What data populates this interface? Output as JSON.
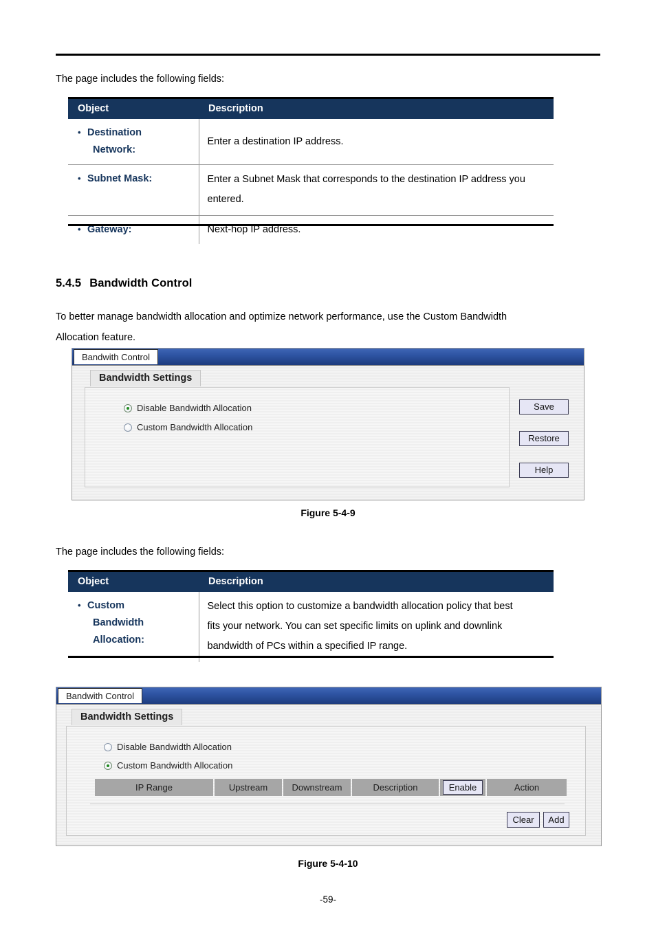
{
  "document": {
    "page_number": "-59-"
  },
  "intro_text_1": "The page includes the following fields:",
  "intro_text_2": "The page includes the following fields:",
  "section": {
    "number": "5.4.5",
    "title": "Bandwidth Control",
    "paragraph_line1": "To better manage bandwidth allocation and optimize network performance, use the Custom Bandwidth",
    "paragraph_line2": "Allocation feature."
  },
  "table1": {
    "headers": {
      "object": "Object",
      "description": "Description"
    },
    "rows": [
      {
        "object_lines": [
          "Destination",
          "Network:"
        ],
        "description_lines": [
          "Enter a destination IP address."
        ]
      },
      {
        "object_lines": [
          "Subnet Mask:"
        ],
        "description_lines": [
          "Enter a Subnet Mask that corresponds to the destination IP address you",
          "entered."
        ]
      },
      {
        "object_lines": [
          "Gateway:"
        ],
        "description_lines": [
          "Next-hop IP address."
        ]
      }
    ]
  },
  "table2": {
    "headers": {
      "object": "Object",
      "description": "Description"
    },
    "rows": [
      {
        "object_lines": [
          "Custom",
          "Bandwidth",
          "Allocation:"
        ],
        "description_lines": [
          "Select this option to customize a bandwidth allocation policy that best",
          "fits your network. You can set specific limits on uplink and downlink",
          "bandwidth of PCs within a specified IP range."
        ]
      }
    ]
  },
  "figure1": {
    "caption": "Figure 5-4-9",
    "tab_label": "Bandwith Control",
    "panel_tab_label": "Bandwidth Settings",
    "radios": [
      {
        "label": "Disable Bandwidth Allocation",
        "selected": true
      },
      {
        "label": "Custom Bandwidth Allocation",
        "selected": false
      }
    ],
    "buttons": {
      "save": "Save",
      "restore": "Restore",
      "help": "Help"
    }
  },
  "figure2": {
    "caption": "Figure 5-4-10",
    "tab_label": "Bandwith Control",
    "panel_tab_label": "Bandwidth Settings",
    "radios": [
      {
        "label": "Disable Bandwidth Allocation",
        "selected": false
      },
      {
        "label": "Custom Bandwidth Allocation",
        "selected": true
      }
    ],
    "grid_headers": {
      "ip_range": "IP Range",
      "upstream": "Upstream",
      "downstream": "Downstream",
      "description": "Description",
      "enable": "Enable",
      "action": "Action"
    },
    "buttons": {
      "clear": "Clear",
      "add": "Add"
    }
  },
  "colors": {
    "table_header_bg": "#16355c",
    "object_text": "#16355c",
    "titlebar_blue": "#2f55a4",
    "grid_header_gray": "#a6a6a6",
    "button_bg": "#e6e6f5",
    "radio_selected_dot": "#1f8a1f"
  }
}
